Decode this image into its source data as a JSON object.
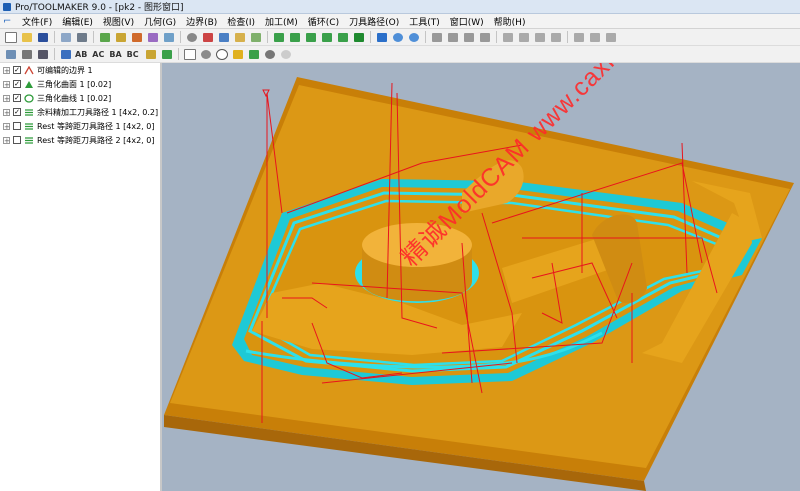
{
  "window": {
    "title": "Pro/TOOLMAKER 9.0 - [pk2 - 图形窗口]"
  },
  "menu": [
    "文件(F)",
    "编辑(E)",
    "视图(V)",
    "几何(G)",
    "边界(B)",
    "检查(I)",
    "加工(M)",
    "循环(C)",
    "刀具路径(O)",
    "工具(T)",
    "窗口(W)",
    "帮助(H)"
  ],
  "toolbar2_labels": [
    "AB",
    "AC",
    "BA",
    "BC"
  ],
  "tree": [
    {
      "label": "可编辑的边界 1",
      "checked": true
    },
    {
      "label": "三角化曲面 1 [0.02]",
      "checked": true
    },
    {
      "label": "三角化曲线 1 [0.02]",
      "checked": true
    },
    {
      "label": "余料精加工刀具路径 1 [4x2, 0.2]",
      "checked": true
    },
    {
      "label": "Rest 等跨距刀具路径 1 [4x2, 0]",
      "checked": false
    },
    {
      "label": "Rest 等跨距刀具路径 2 [4x2, 0]",
      "checked": false
    }
  ],
  "watermark": "精诚MoldCAM www.caxit.com",
  "colors": {
    "viewport_bg": "#a5b3c4",
    "part": "#d9940f",
    "toolpath_cyan": "#2fe0ea",
    "toolpath_red": "#e8141c"
  }
}
